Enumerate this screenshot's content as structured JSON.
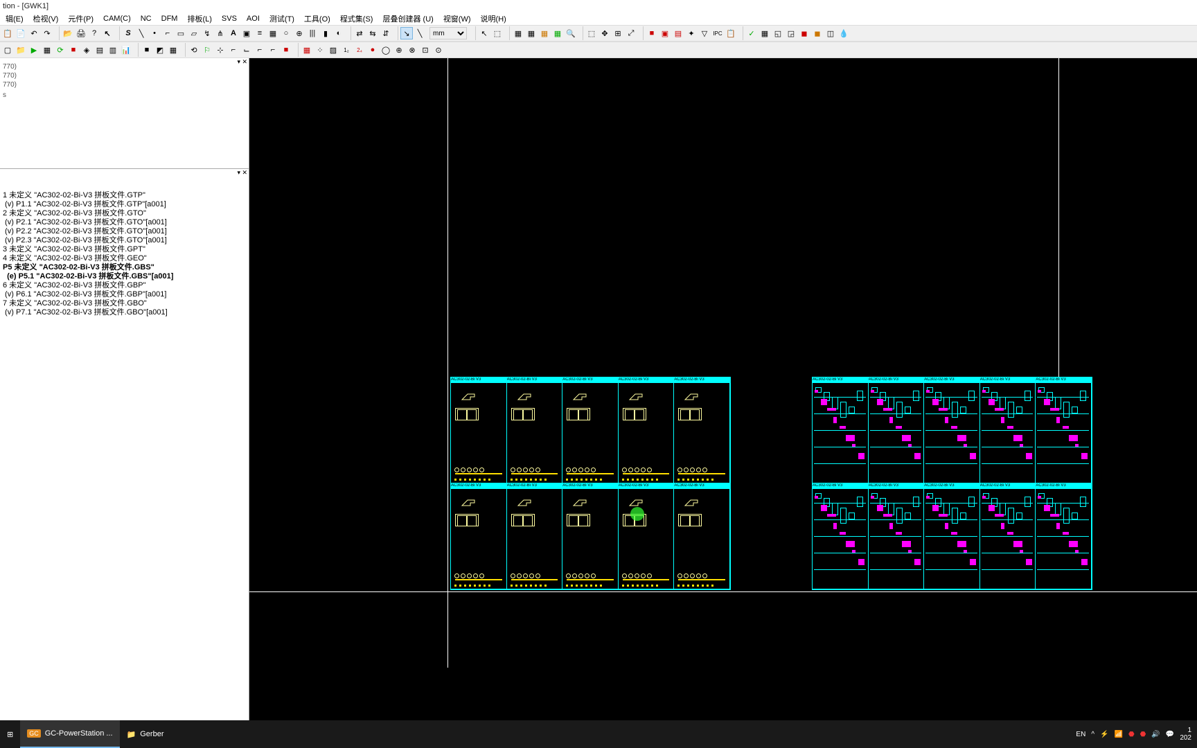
{
  "window": {
    "title": "tion - [GWK1]"
  },
  "menu": {
    "items": [
      "辑(E)",
      "检视(V)",
      "元件(P)",
      "CAM(C)",
      "NC",
      "DFM",
      "排板(L)",
      "SVS",
      "AOI",
      "测试(T)",
      "工具(O)",
      "程式集(S)",
      "层叠创建器 (U)",
      "视窗(W)",
      "说明(H)"
    ]
  },
  "units": {
    "selected": "mm"
  },
  "panel1": {
    "lines": [
      "",
      "770)",
      "770)",
      "770)",
      "",
      "s"
    ]
  },
  "layers": [
    {
      "t": "1 未定义 \"AC302-02-Bi-V3 拼板文件.GTP\"",
      "b": false
    },
    {
      "t": " (v) P1.1 \"AC302-02-Bi-V3 拼板文件.GTP\"[a001]",
      "b": false
    },
    {
      "t": "2 未定义 \"AC302-02-Bi-V3 拼板文件.GTO\"",
      "b": false
    },
    {
      "t": " (v) P2.1 \"AC302-02-Bi-V3 拼板文件.GTO\"[a001]",
      "b": false
    },
    {
      "t": " (v) P2.2 \"AC302-02-Bi-V3 拼板文件.GTO\"[a001]",
      "b": false
    },
    {
      "t": " (v) P2.3 \"AC302-02-Bi-V3 拼板文件.GTO\"[a001]",
      "b": false
    },
    {
      "t": "3 未定义 \"AC302-02-Bi-V3 拼板文件.GPT\"",
      "b": false
    },
    {
      "t": "4 未定义 \"AC302-02-Bi-V3 拼板文件.GEO\"",
      "b": false
    },
    {
      "t": "P5 未定义 \"AC302-02-Bi-V3 拼板文件.GBS\"",
      "b": true
    },
    {
      "t": "  (e) P5.1 \"AC302-02-Bi-V3 拼板文件.GBS\"[a001]",
      "b": true
    },
    {
      "t": "6 未定义 \"AC302-02-Bi-V3 拼板文件.GBP\"",
      "b": false
    },
    {
      "t": " (v) P6.1 \"AC302-02-Bi-V3 拼板文件.GBP\"[a001]",
      "b": false
    },
    {
      "t": "7 未定义 \"AC302-02-Bi-V3 拼板文件.GBO\"",
      "b": false
    },
    {
      "t": " (v) P7.1 \"AC302-02-Bi-V3 拼板文件.GBO\"[a001]",
      "b": false
    }
  ],
  "cell_header": "AC302-02-Bi V3",
  "taskbar": {
    "apps": [
      {
        "label": "GC-PowerStation ...",
        "icon": "GC",
        "active": true
      },
      {
        "label": "Gerber",
        "icon": "📁",
        "active": false
      }
    ],
    "lang": "EN",
    "time_top": "1",
    "time_bot": "202"
  }
}
